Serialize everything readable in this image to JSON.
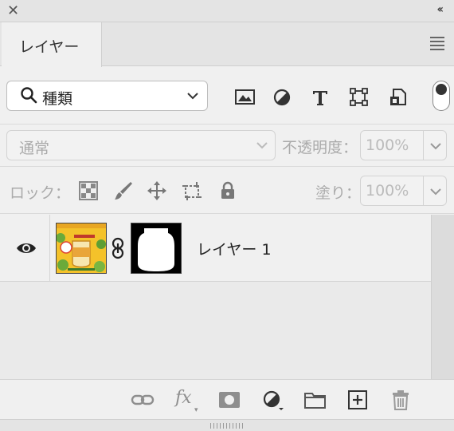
{
  "window": {
    "close_glyph": "✕",
    "collapse_glyph": "‹‹"
  },
  "panel": {
    "tab_label": "レイヤー",
    "menu_icon": "hamburger-menu-icon"
  },
  "filter": {
    "kind_label": "種類",
    "kind_icon": "search-icon",
    "filter_icons": [
      "image-filter-icon",
      "adjustment-filter-icon",
      "type-filter-icon",
      "shape-filter-icon",
      "smart-object-filter-icon"
    ],
    "toggle_on": true
  },
  "blend": {
    "mode_label": "通常",
    "opacity_label": "不透明度：",
    "opacity_value": "100%"
  },
  "lock": {
    "label": "ロック：",
    "icons": [
      "lock-transparent-pixels-icon",
      "lock-image-pixels-icon",
      "lock-position-icon",
      "lock-artboard-icon",
      "lock-all-icon"
    ],
    "fill_label": "塗り：",
    "fill_value": "100%"
  },
  "layers": [
    {
      "name": "レイヤー 1",
      "visible": true,
      "linked": true,
      "has_mask": true
    }
  ],
  "bottom_toolbar": {
    "icons": [
      "link-layers-icon",
      "fx-icon",
      "add-mask-icon",
      "adjustment-layer-icon",
      "group-folder-icon",
      "new-layer-icon",
      "trash-icon"
    ],
    "fx_label": "fx"
  },
  "colors": {
    "panel_bg": "#f0f0f0",
    "header_bg": "#e4e4e4",
    "icon_dark": "#333333",
    "icon_disabled": "#8e8e8e",
    "thumbnail_yellow": "#f5c52b"
  }
}
